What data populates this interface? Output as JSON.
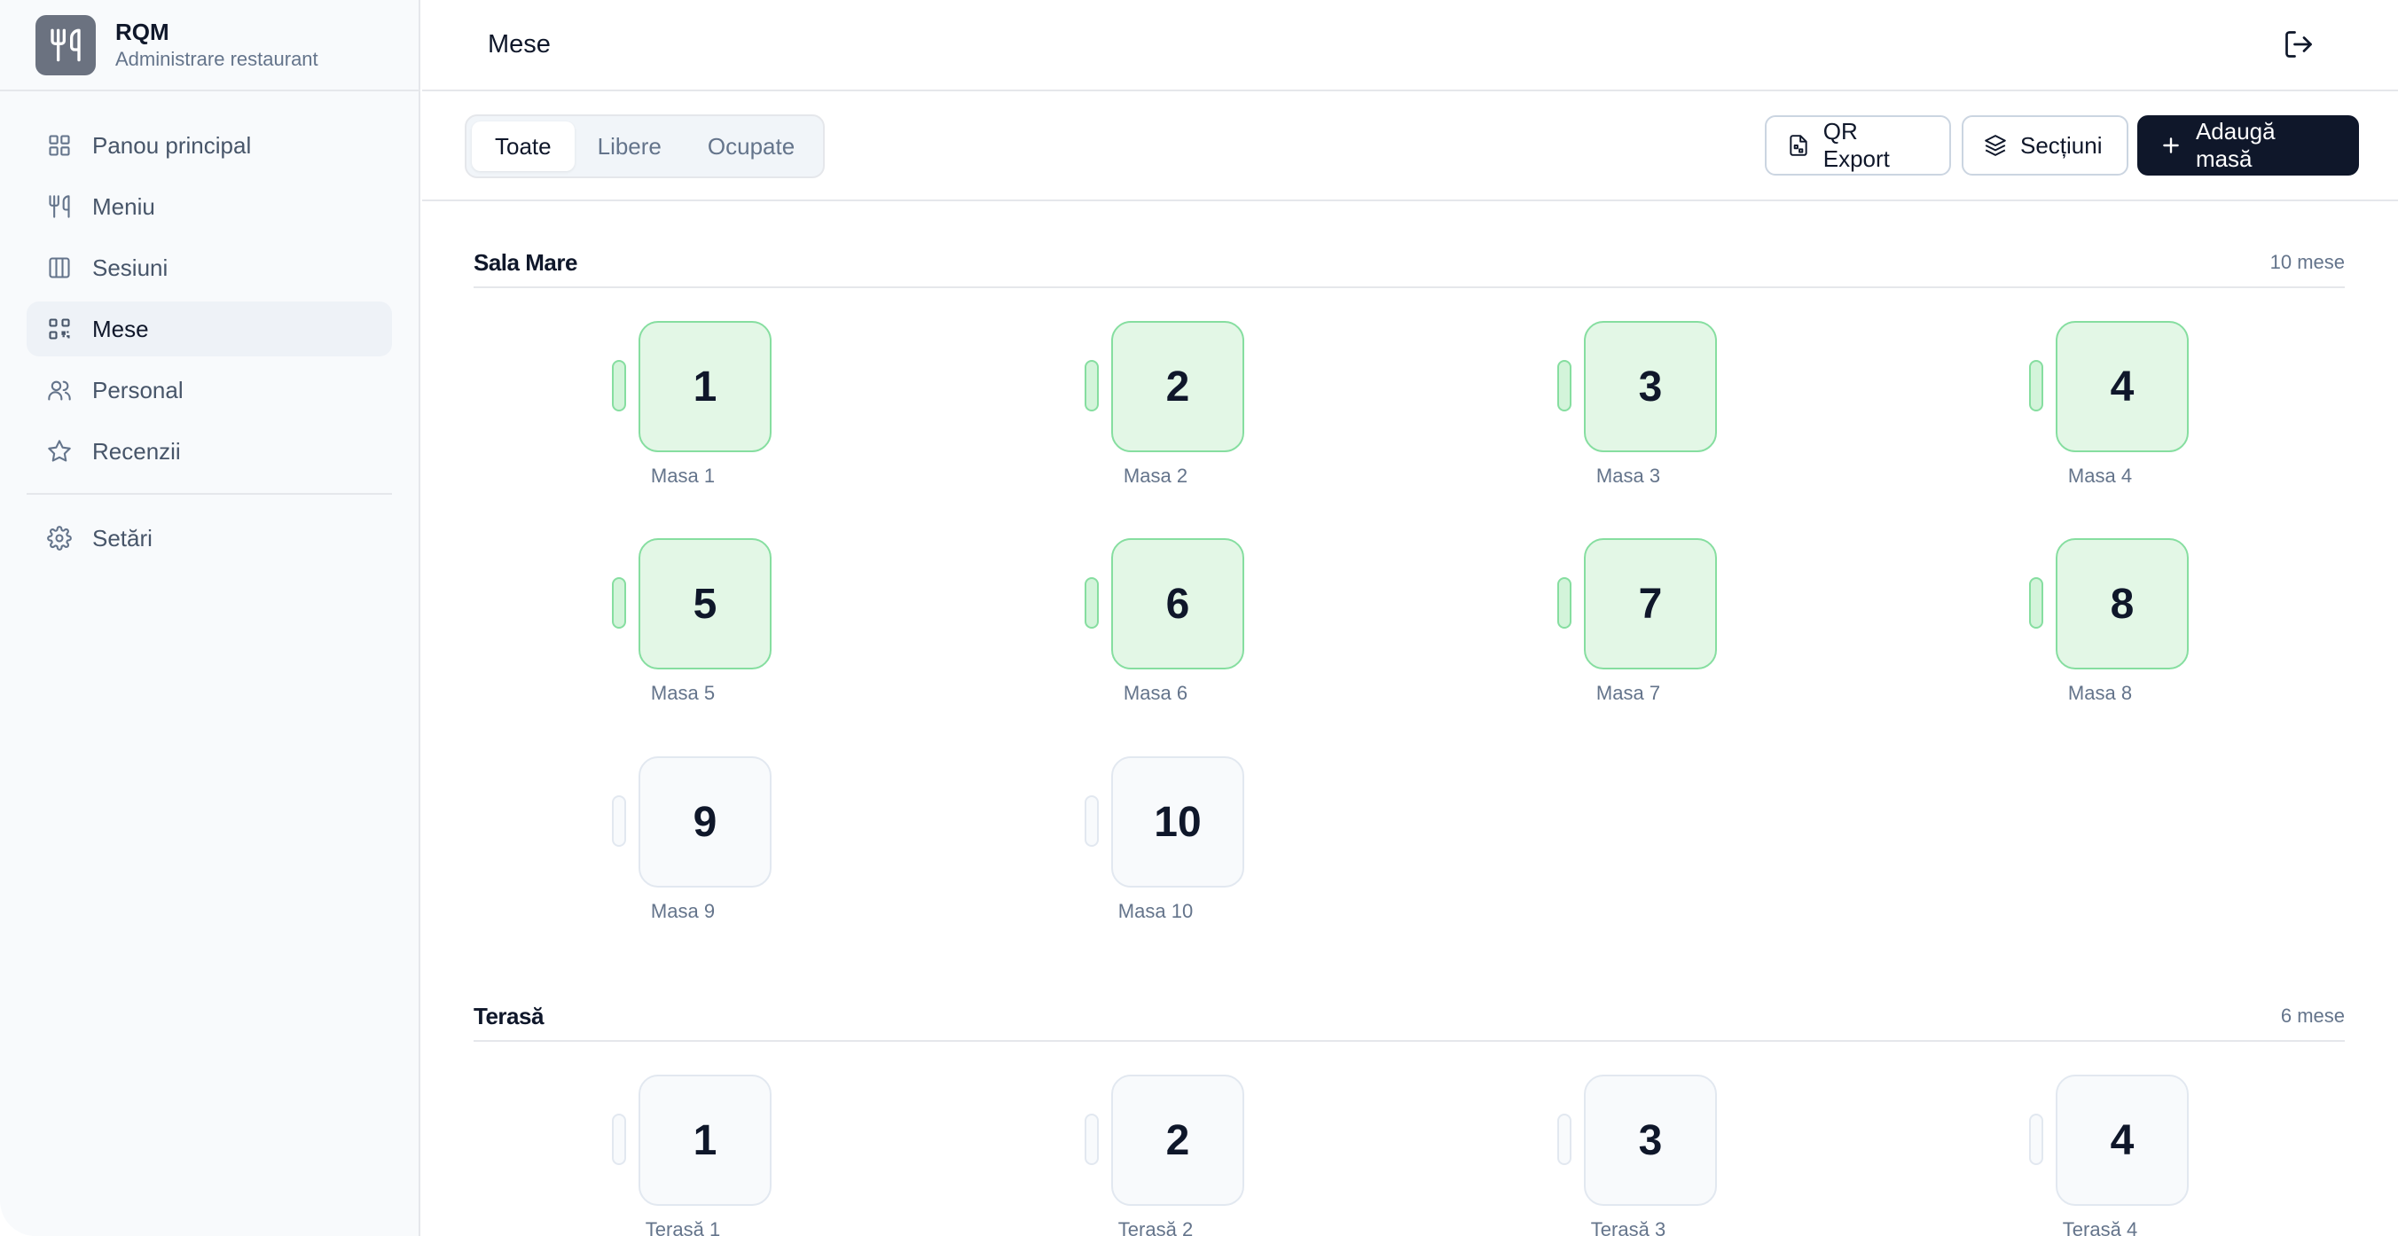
{
  "brand": {
    "title": "RQM",
    "subtitle": "Administrare restaurant"
  },
  "sidebar": {
    "items": [
      {
        "label": "Panou principal",
        "icon": "grid-icon"
      },
      {
        "label": "Meniu",
        "icon": "utensils-icon"
      },
      {
        "label": "Sesiuni",
        "icon": "columns-icon"
      },
      {
        "label": "Mese",
        "icon": "qr-code-icon",
        "active": true
      },
      {
        "label": "Personal",
        "icon": "users-icon"
      },
      {
        "label": "Recenzii",
        "icon": "star-icon"
      }
    ],
    "settings": {
      "label": "Setări",
      "icon": "gear-icon"
    }
  },
  "header": {
    "title": "Mese"
  },
  "filters": {
    "tabs": [
      "Toate",
      "Libere",
      "Ocupate"
    ],
    "active": "Toate"
  },
  "actions": {
    "qr_export": "QR Export",
    "sections": "Secțiuni",
    "add_table": "Adaugă masă"
  },
  "sections": [
    {
      "title": "Sala Mare",
      "count": "10 mese",
      "tables": [
        {
          "number": "1",
          "name": "Masa 1",
          "status": "free"
        },
        {
          "number": "2",
          "name": "Masa 2",
          "status": "free"
        },
        {
          "number": "3",
          "name": "Masa 3",
          "status": "free"
        },
        {
          "number": "4",
          "name": "Masa 4",
          "status": "free"
        },
        {
          "number": "5",
          "name": "Masa 5",
          "status": "free"
        },
        {
          "number": "6",
          "name": "Masa 6",
          "status": "free"
        },
        {
          "number": "7",
          "name": "Masa 7",
          "status": "free"
        },
        {
          "number": "8",
          "name": "Masa 8",
          "status": "free"
        },
        {
          "number": "9",
          "name": "Masa 9",
          "status": "neutral"
        },
        {
          "number": "10",
          "name": "Masa 10",
          "status": "neutral"
        }
      ]
    },
    {
      "title": "Terasă",
      "count": "6 mese",
      "tables": [
        {
          "number": "1",
          "name": "Terasă 1",
          "status": "neutral"
        },
        {
          "number": "2",
          "name": "Terasă 2",
          "status": "neutral"
        },
        {
          "number": "3",
          "name": "Terasă 3",
          "status": "neutral"
        },
        {
          "number": "4",
          "name": "Terasă 4",
          "status": "neutral"
        }
      ]
    }
  ],
  "colors": {
    "accent_dark": "#0f172a",
    "free_fill": "#e3f7e6",
    "free_border": "#86dea0",
    "neutral_fill": "#f8fafc"
  }
}
